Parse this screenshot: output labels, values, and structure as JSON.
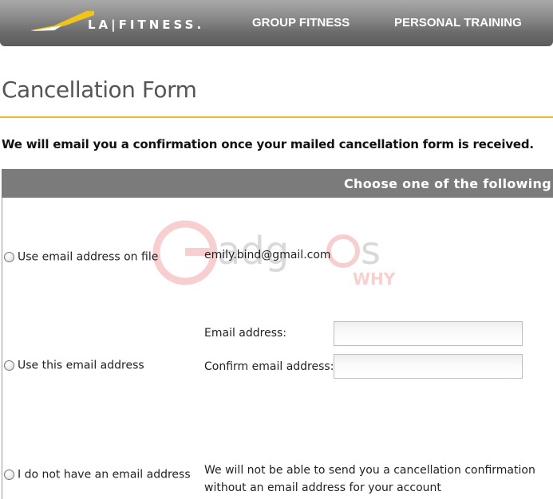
{
  "header": {
    "logo_text": "LA|FITNESS.",
    "nav": [
      {
        "label": "GROUP FITNESS"
      },
      {
        "label": "PERSONAL TRAINING"
      }
    ]
  },
  "page": {
    "title": "Cancellation Form",
    "notice": "We will email you a confirmation once your mailed cancellation form is received."
  },
  "options_panel": {
    "header": "Choose one of the following",
    "options": [
      {
        "label": "Use email address on file",
        "selected": false,
        "value": "emily.bind@gmail.com"
      },
      {
        "label": "Use this email address",
        "selected": false,
        "fields": [
          {
            "label": "Email address:",
            "value": "",
            "placeholder": ""
          },
          {
            "label": "Confirm email address:",
            "value": "",
            "placeholder": ""
          }
        ]
      },
      {
        "label": "I do not have an email address",
        "selected": false,
        "message": "We will not be able to send you a cancellation confirmation without an email address for your account"
      }
    ]
  },
  "watermark": {
    "text_main": "Gadgets",
    "text_sub": "WHY"
  },
  "colors": {
    "header_gray": "#7a7a7a",
    "accent_gold": "#e8b92f",
    "panel_header": "#7b7b7b",
    "watermark_red": "#e4292f"
  }
}
